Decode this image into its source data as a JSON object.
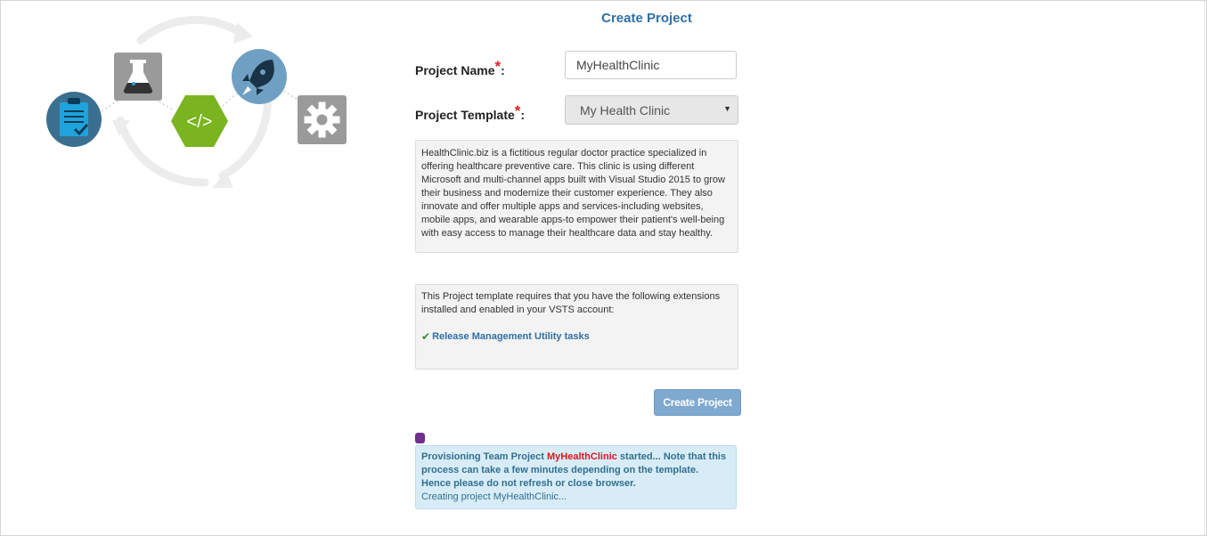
{
  "page": {
    "title": "Create Project"
  },
  "form": {
    "project_name_label": "Project Name",
    "project_name_value": "MyHealthClinic",
    "project_template_label": "Project Template",
    "project_template_value": "My Health Clinic",
    "required_marker": "*",
    "label_suffix": ":"
  },
  "template_description": "HealthClinic.biz is a fictitious regular doctor practice specialized in offering healthcare preventive care. This clinic is using different Microsoft and multi-channel apps built with Visual Studio 2015 to grow their business and modernize their customer experience. They also innovate and offer multiple apps and services-including websites, mobile apps, and wearable apps-to empower their patient's well-being with easy access to manage their healthcare data and stay healthy.",
  "extensions": {
    "intro": "This Project template requires that you have the following extensions installed and enabled in your VSTS account:",
    "items": [
      {
        "check": "✔",
        "name": "Release Management Utility tasks"
      }
    ]
  },
  "buttons": {
    "create_project": "Create Project"
  },
  "status": {
    "prefix": "Provisioning Team Project ",
    "project": "MyHealthClinic",
    "suffix": " started... Note that this process can take a few minutes depending on the template. Hence please do not refresh or close browser.",
    "progress": "Creating project MyHealthClinic..."
  },
  "colors": {
    "accent": "#2f6fa5",
    "required": "#e02020",
    "button": "#7fa9cf",
    "alert_bg": "#d8ecf7",
    "progress_dot": "#6f2f8c",
    "code_hex": "#7ab41f"
  },
  "icons": {
    "clipboard": "clipboard-icon",
    "flask": "flask-icon",
    "code": "code-icon",
    "rocket": "rocket-icon",
    "gear": "gear-icon"
  }
}
